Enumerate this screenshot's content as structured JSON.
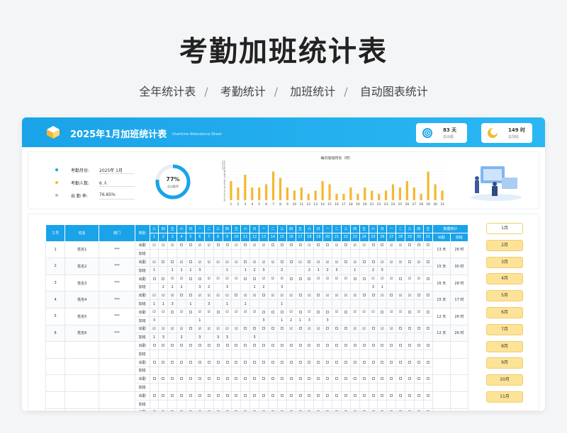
{
  "title": "考勤加班统计表",
  "subtitle": [
    "全年统计表",
    "考勤统计",
    "加班统计",
    "自动图表统计"
  ],
  "sheet": {
    "title": "2025年1月加班统计表",
    "en_title": "Overtime Attendance Sheet"
  },
  "stats": [
    {
      "value": "83 天",
      "label": "总出勤",
      "icon": "fingerprint-icon"
    },
    {
      "value": "149 时",
      "label": "总加班",
      "icon": "moon-icon"
    }
  ],
  "info": [
    {
      "key": "考勤月份:",
      "value": "2025年   1月",
      "color": "#1aa3e8"
    },
    {
      "key": "考勤人数:",
      "value": "6   人",
      "color": "#f5b82e"
    },
    {
      "key": "出  勤  率:",
      "value": "76.85%",
      "color": "#bbbbbb"
    }
  ],
  "donut": {
    "percent": 77,
    "pct_text": "77%",
    "label": "总出勤率"
  },
  "chart_data": {
    "type": "bar",
    "title": "每日加班时长（时）",
    "x": [
      1,
      2,
      3,
      4,
      5,
      6,
      7,
      8,
      9,
      10,
      11,
      12,
      13,
      14,
      15,
      16,
      17,
      18,
      19,
      20,
      21,
      22,
      23,
      24,
      25,
      26,
      27,
      28,
      29,
      30,
      31
    ],
    "values": [
      6,
      4,
      8,
      4,
      4,
      5,
      9,
      7,
      4,
      3,
      4,
      2,
      3,
      6,
      5,
      2,
      2,
      4,
      2,
      4,
      3,
      2,
      3,
      5,
      4,
      6,
      4,
      2,
      9,
      5,
      3
    ],
    "ylim": [
      0,
      12
    ],
    "yticks": [
      0,
      1,
      2,
      3,
      4,
      5,
      6,
      7,
      8,
      9,
      10,
      11,
      12
    ],
    "color": "#f5b82e"
  },
  "table": {
    "headers": {
      "id": "工号",
      "name": "姓名",
      "dept": "部门",
      "type": "类别",
      "summary": "数据统计",
      "att": "出勤",
      "ot": "加班"
    },
    "weekdays": [
      "三",
      "四",
      "五",
      "六",
      "日",
      "一",
      "二",
      "三",
      "四",
      "五",
      "六",
      "日",
      "一",
      "二",
      "三",
      "四",
      "五",
      "六",
      "日",
      "一",
      "二",
      "三",
      "四",
      "五",
      "六",
      "日",
      "一",
      "二",
      "三",
      "四",
      "五"
    ],
    "days": [
      "1",
      "2",
      "3",
      "4",
      "5",
      "6",
      "7",
      "8",
      "9",
      "10",
      "11",
      "12",
      "13",
      "14",
      "15",
      "16",
      "17",
      "18",
      "19",
      "20",
      "21",
      "22",
      "23",
      "24",
      "25",
      "26",
      "27",
      "28",
      "29",
      "30",
      "31"
    ],
    "employees": [
      {
        "id": "1",
        "name": "姓名1",
        "dept": "***",
        "att_label": "出勤",
        "ot_label": "加班",
        "att": "xxx..xx..x.xx....x..x.xx..xx..",
        "ot": " 1 2   1 1 3 1         3 3                     3 1 2 1 3",
        "att_total": "13 天",
        "ot_total": "28 时"
      },
      {
        "id": "2",
        "name": "姓名2",
        "dept": "***",
        "att_label": "出勤",
        "ot_label": "加班",
        "att": "x..x.xxxxx.xxx..x.xxx.x..xxx.x.",
        "ot": "1   1 1 1 3     1   1 2 3   2     2 1 2 3   1   2 5",
        "att_total": "15 天",
        "ot_total": "30 时"
      },
      {
        "id": "3",
        "name": "姓名3",
        "dept": "***",
        "att_label": "出勤",
        "ot_label": "加班",
        "att": "..xx..xxxx..xxx...xxxx..xxx.xx.",
        "ot": "  2 2 2   3 2   3     1 2   3                   3 1",
        "att_total": "16 天",
        "ot_total": "28 时"
      },
      {
        "id": "4",
        "name": "姓名4",
        "dept": "***",
        "att_label": "出勤",
        "ot_label": "加班",
        "att": "xxx..xxxx.xx.xxx.x.xxxx..x.xx..",
        "ot": "1 1 3   1   3   1   1       1",
        "att_total": "15 天",
        "ot_total": "17 时"
      },
      {
        "id": "5",
        "name": "姓名5",
        "dept": "***",
        "att_label": "出勤",
        "ot_label": "加班",
        "att": "xx.x.xx.xxxx...x.x..x.xxx.xx.x.",
        "ot": "3         1             3   1 2 1 3   3",
        "att_total": "12 天",
        "ot_total": "26 时"
      },
      {
        "id": "6",
        "name": "姓名6",
        "dept": "***",
        "att_label": "出勤",
        "ot_label": "加班",
        "att": "xxxx.xxxxx.....x.xx...xx.xx....",
        "ot": "1 3   2   3   3 3     3",
        "att_total": "12 天",
        "ot_total": "26 时"
      }
    ],
    "blank_rows": 5,
    "blank_att_label": "出勤",
    "blank_ot_label": "加班"
  },
  "months": [
    "1月",
    "2月",
    "3月",
    "4月",
    "5月",
    "6月",
    "7月",
    "8月",
    "9月",
    "10月",
    "11月"
  ]
}
